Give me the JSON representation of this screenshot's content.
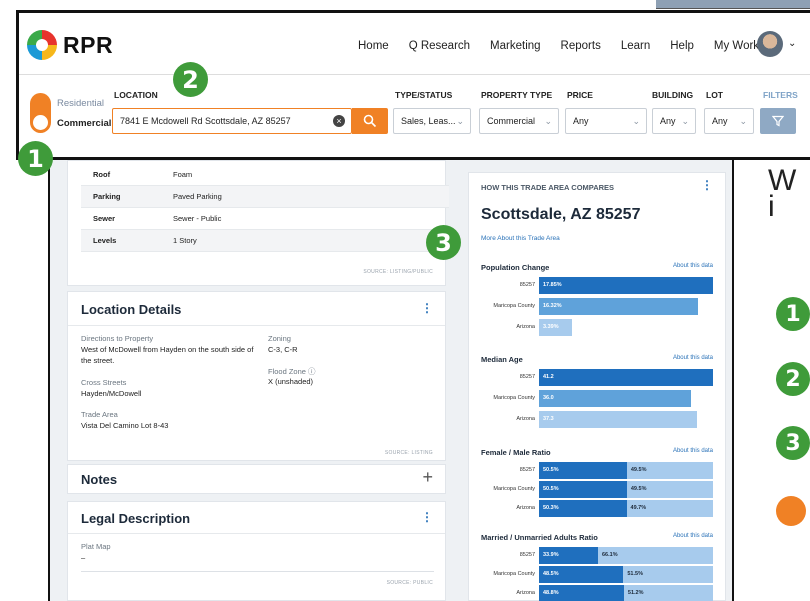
{
  "app": {
    "brand": "RPR"
  },
  "nav": [
    "Home",
    "Q Research",
    "Marketing",
    "Reports",
    "Learn",
    "Help",
    "My Work"
  ],
  "toggle": {
    "residential": "Residential",
    "commercial": "Commercial",
    "selected": "Commercial"
  },
  "search": {
    "location_label": "LOCATION",
    "location_value": "7841 E Mcdowell Rd Scottsdale, AZ 85257",
    "type_label": "TYPE/STATUS",
    "type_value": "Sales, Leas...",
    "ptype_label": "PROPERTY TYPE",
    "ptype_value": "Commercial",
    "price_label": "PRICE",
    "price_value": "Any",
    "building_label": "BUILDING",
    "building_value": "Any",
    "lot_label": "LOT",
    "lot_value": "Any",
    "filters_label": "FILTERS"
  },
  "callouts": [
    "1",
    "2",
    "3"
  ],
  "details": {
    "rows": [
      {
        "k": "Roof",
        "v": "Foam"
      },
      {
        "k": "Parking",
        "v": "Paved Parking"
      },
      {
        "k": "Sewer",
        "v": "Sewer - Public"
      },
      {
        "k": "Levels",
        "v": "1 Story"
      }
    ],
    "source": "SOURCE: LISTING/PUBLIC"
  },
  "location_details": {
    "title": "Location Details",
    "directions_label": "Directions to Property",
    "directions_value": "West of McDowell from Hayden on the south side of the street.",
    "cross_label": "Cross Streets",
    "cross_value": "Hayden/McDowell",
    "area_label": "Trade Area",
    "area_value": "Vista Del Camino Lot 8-43",
    "zoning_label": "Zoning",
    "zoning_value": "C-3, C-R",
    "flood_label": "Flood Zone ⓘ",
    "flood_value": "X (unshaded)",
    "source": "SOURCE: LISTING"
  },
  "notes": {
    "title": "Notes",
    "plus": "+"
  },
  "legal": {
    "title": "Legal Description",
    "plat_label": "Plat Map",
    "plat_value": "–",
    "source": "SOURCE: PUBLIC"
  },
  "trade": {
    "header": "HOW THIS TRADE AREA COMPARES",
    "title": "Scottsdale, AZ 85257",
    "link": "More About this Trade Area",
    "about": "About this data"
  },
  "chart_data": [
    {
      "type": "bar",
      "title": "Population Change",
      "categories": [
        "85257",
        "Maricopa County",
        "Arizona"
      ],
      "values": [
        "17.85%",
        "16.32%",
        "3.39%"
      ]
    },
    {
      "type": "bar",
      "title": "Median Age",
      "categories": [
        "85257",
        "Maricopa County",
        "Arizona"
      ],
      "values": [
        "41.2",
        "36.0",
        "37.3"
      ]
    },
    {
      "type": "bar",
      "title": "Female / Male Ratio",
      "categories": [
        "85257",
        "Maricopa County",
        "Arizona"
      ],
      "series": [
        {
          "values": [
            "50.5%",
            "50.5%",
            "50.3%"
          ]
        },
        {
          "values": [
            "49.5%",
            "49.5%",
            "49.7%"
          ]
        }
      ]
    },
    {
      "type": "bar",
      "title": "Married / Unmarried Adults Ratio",
      "categories": [
        "85257",
        "Maricopa County",
        "Arizona"
      ],
      "series": [
        {
          "values": [
            "33.9%",
            "48.5%",
            "48.8%"
          ]
        },
        {
          "values": [
            "66.1%",
            "51.5%",
            "51.2%"
          ]
        }
      ]
    }
  ],
  "side": {
    "w1": "W",
    "w2": "i"
  },
  "colors": {
    "accent": "#f08125",
    "callout": "#3f9b3a",
    "bar_dark": "#1f6fbe",
    "bar_light": "#a7cbed"
  }
}
